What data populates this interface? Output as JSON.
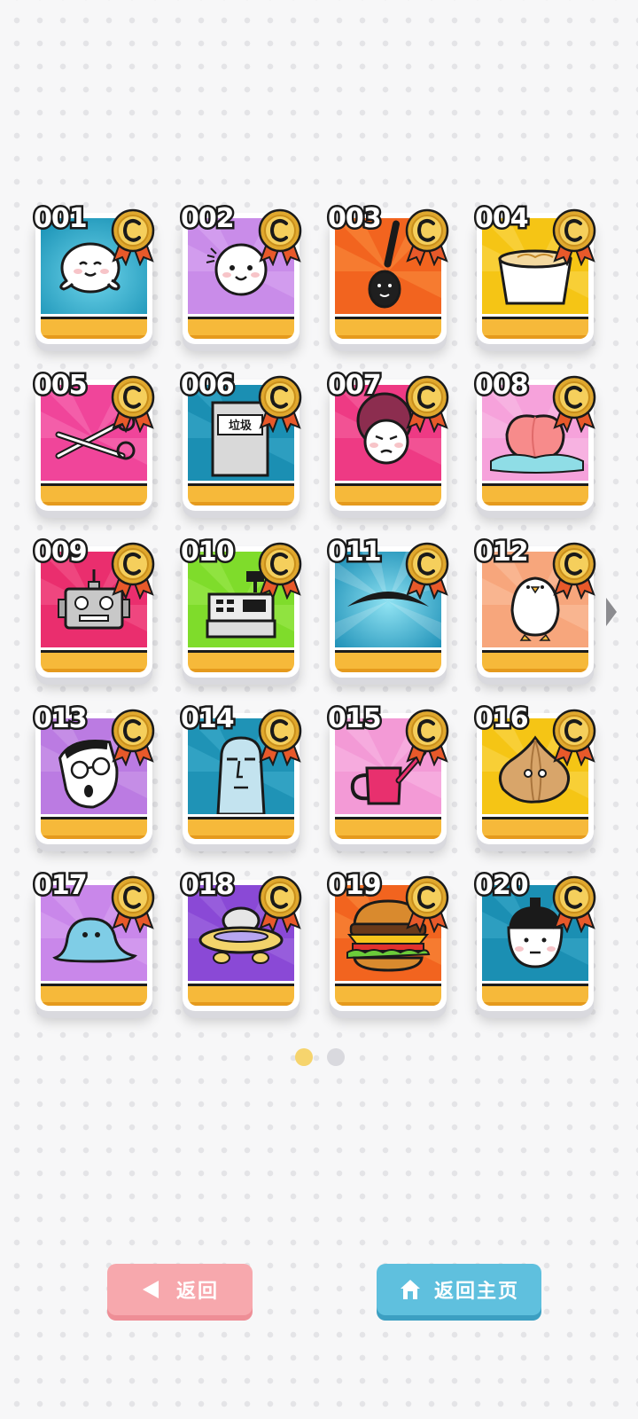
{
  "cards": [
    {
      "number": "001",
      "icon": "round-ghost-icon"
    },
    {
      "number": "002",
      "icon": "baby-face-icon"
    },
    {
      "number": "003",
      "icon": "ladle-icon"
    },
    {
      "number": "004",
      "icon": "noodle-cup-icon"
    },
    {
      "number": "005",
      "icon": "scissors-icon"
    },
    {
      "number": "006",
      "icon": "trash-bin-icon",
      "art_text": "垃圾"
    },
    {
      "number": "007",
      "icon": "curly-hair-face-icon"
    },
    {
      "number": "008",
      "icon": "peach-icon"
    },
    {
      "number": "009",
      "icon": "robot-head-icon"
    },
    {
      "number": "010",
      "icon": "cash-register-icon"
    },
    {
      "number": "011",
      "icon": "eyebrow-mountain-icon"
    },
    {
      "number": "012",
      "icon": "white-bird-icon"
    },
    {
      "number": "013",
      "icon": "glasses-man-icon"
    },
    {
      "number": "014",
      "icon": "moai-head-icon"
    },
    {
      "number": "015",
      "icon": "watering-can-icon"
    },
    {
      "number": "016",
      "icon": "onion-icon"
    },
    {
      "number": "017",
      "icon": "blue-blob-icon"
    },
    {
      "number": "018",
      "icon": "ufo-icon"
    },
    {
      "number": "019",
      "icon": "hamburger-icon"
    },
    {
      "number": "020",
      "icon": "topknot-face-icon"
    }
  ],
  "pagination": {
    "total_pages": 2,
    "current_page": 1
  },
  "buttons": {
    "back_label": "返回",
    "home_label": "返回主页"
  },
  "colors": {
    "bar": "#f6b93a",
    "back_button": "#f7a8ad",
    "home_button": "#5fc0de",
    "dot_active": "#f6d46d",
    "dot_inactive": "#d9d9de"
  }
}
